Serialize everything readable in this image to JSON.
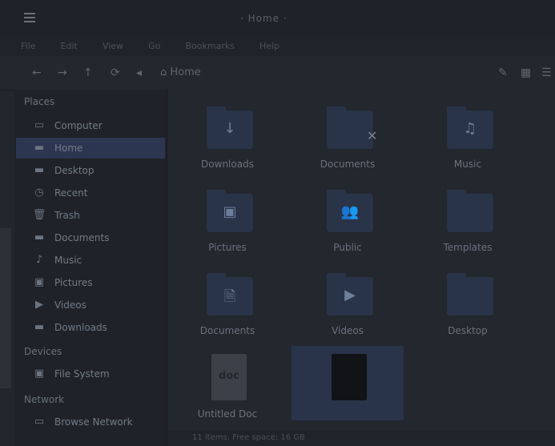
{
  "window": {
    "title": "· Home ·"
  },
  "menubar": {
    "items": [
      "File",
      "Edit",
      "View",
      "Go",
      "Bookmarks",
      "Help"
    ]
  },
  "toolbar": {
    "path": "Home"
  },
  "sidebar": {
    "sections": {
      "places": "Places",
      "devices": "Devices",
      "network": "Network"
    },
    "places_items": [
      {
        "label": "Computer",
        "icon": "computer-icon"
      },
      {
        "label": "Home",
        "icon": "home-icon"
      },
      {
        "label": "Desktop",
        "icon": "desktop-icon"
      },
      {
        "label": "Recent",
        "icon": "recent-icon"
      },
      {
        "label": "Trash",
        "icon": "trash-icon"
      },
      {
        "label": "Documents",
        "icon": "documents-icon"
      },
      {
        "label": "Music",
        "icon": "music-icon"
      },
      {
        "label": "Pictures",
        "icon": "pictures-icon"
      },
      {
        "label": "Videos",
        "icon": "videos-icon"
      },
      {
        "label": "Downloads",
        "icon": "downloads-icon"
      }
    ],
    "devices_items": [
      {
        "label": "File System",
        "icon": "drive-icon"
      }
    ],
    "network_items": [
      {
        "label": "Browse Network",
        "icon": "network-icon"
      }
    ]
  },
  "files": [
    {
      "label": "Downloads",
      "glyph": "↓"
    },
    {
      "label": "Documents",
      "glyph": ""
    },
    {
      "label": "Music",
      "glyph": "♫"
    },
    {
      "label": "Pictures",
      "glyph": "▣"
    },
    {
      "label": "Public",
      "glyph": "👥"
    },
    {
      "label": "Templates",
      "glyph": ""
    },
    {
      "label": "Documents",
      "glyph": "🗎"
    },
    {
      "label": "Videos",
      "glyph": "▶"
    },
    {
      "label": "Desktop",
      "glyph": ""
    },
    {
      "label": "Untitled Doc",
      "glyph": "doc"
    },
    {
      "label": "",
      "glyph": ""
    }
  ],
  "status": {
    "left": "11 items, Free space: 16 GB"
  }
}
